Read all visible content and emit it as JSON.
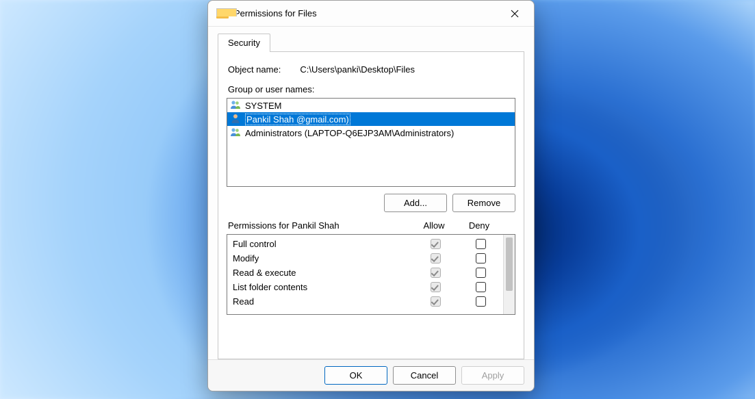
{
  "window": {
    "title": "Permissions for Files"
  },
  "tabs": {
    "security": "Security"
  },
  "object": {
    "label": "Object name:",
    "path": "C:\\Users\\panki\\Desktop\\Files"
  },
  "groupList": {
    "label": "Group or user names:",
    "items": [
      {
        "icon": "group-icon",
        "text": "SYSTEM",
        "selected": false
      },
      {
        "icon": "user-icon",
        "text": "Pankil Shah               @gmail.com)",
        "selected": true
      },
      {
        "icon": "group-icon",
        "text": "Administrators (LAPTOP-Q6EJP3AM\\Administrators)",
        "selected": false
      }
    ]
  },
  "buttons": {
    "add": "Add...",
    "remove": "Remove",
    "ok": "OK",
    "cancel": "Cancel",
    "apply": "Apply"
  },
  "permissions": {
    "header": "Permissions for Pankil Shah",
    "allow": "Allow",
    "deny": "Deny",
    "rows": [
      {
        "label": "Full control",
        "allow_checked": true,
        "allow_disabled": true,
        "deny_checked": false,
        "deny_disabled": false
      },
      {
        "label": "Modify",
        "allow_checked": true,
        "allow_disabled": true,
        "deny_checked": false,
        "deny_disabled": false
      },
      {
        "label": "Read & execute",
        "allow_checked": true,
        "allow_disabled": true,
        "deny_checked": false,
        "deny_disabled": false
      },
      {
        "label": "List folder contents",
        "allow_checked": true,
        "allow_disabled": true,
        "deny_checked": false,
        "deny_disabled": false
      },
      {
        "label": "Read",
        "allow_checked": true,
        "allow_disabled": true,
        "deny_checked": false,
        "deny_disabled": false
      }
    ]
  }
}
